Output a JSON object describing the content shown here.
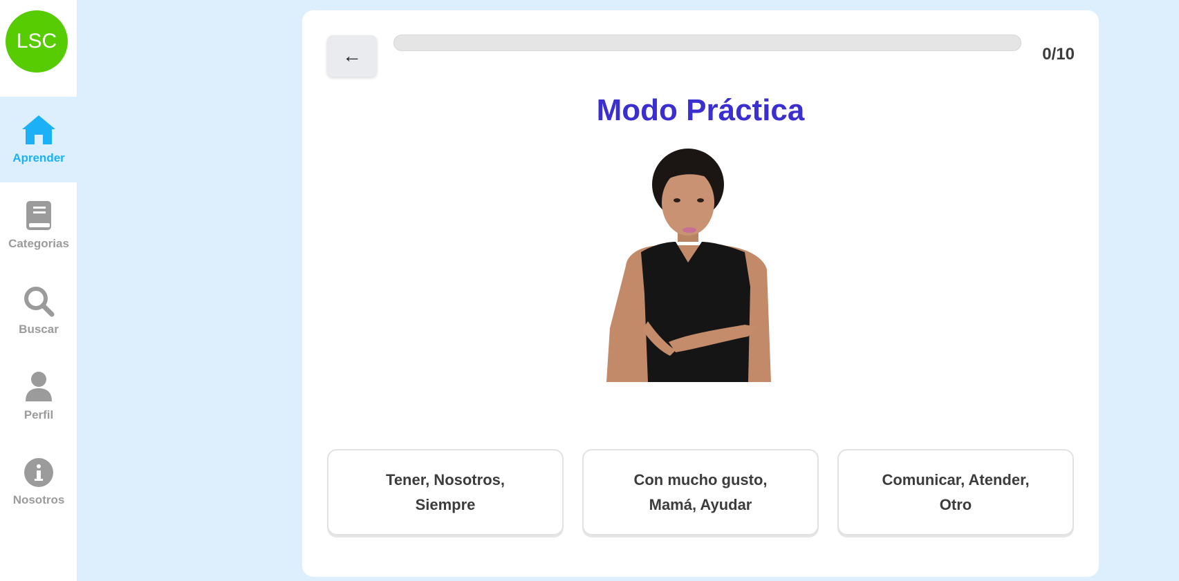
{
  "app": {
    "logo_text": "LSC",
    "brand_color": "#58cc02",
    "accent_color": "#1cb0f6"
  },
  "sidebar": {
    "items": [
      {
        "label": "Aprender",
        "icon": "home-icon",
        "active": true
      },
      {
        "label": "Categorias",
        "icon": "book-icon",
        "active": false
      },
      {
        "label": "Buscar",
        "icon": "search-icon",
        "active": false
      },
      {
        "label": "Perfil",
        "icon": "user-icon",
        "active": false
      },
      {
        "label": "Nosotros",
        "icon": "info-icon",
        "active": false
      }
    ]
  },
  "practice": {
    "back_label": "←",
    "progress_fraction": 0,
    "counter": "0/10",
    "title": "Modo Práctica",
    "title_color": "#3b2fcf",
    "options": [
      "Tener, Nosotros, Siempre",
      "Con mucho gusto, Mamá, Ayudar",
      "Comunicar, Atender, Otro"
    ]
  }
}
